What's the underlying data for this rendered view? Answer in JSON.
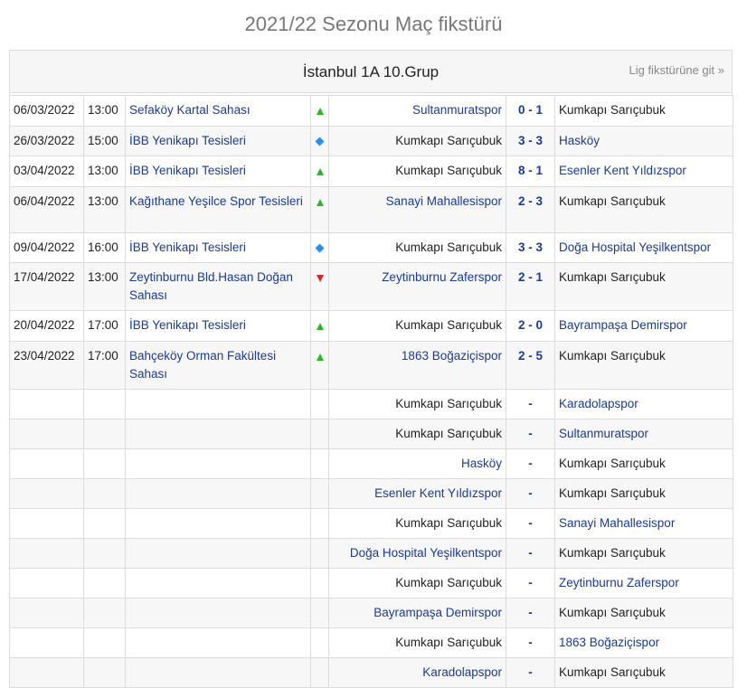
{
  "page": {
    "title": "2021/22 Sezonu Maç fikstürü",
    "group_title": "İstanbul 1A 10.Grup",
    "lig_link": "Lig fikstürüne git »"
  },
  "team_focus": "Kumkapı Sarıçubuk",
  "matches": [
    {
      "date": "06/03/2022",
      "time": "13:00",
      "venue": "Sefaköy Kartal Sahası",
      "result": "win",
      "home": "Sultanmuratspor",
      "score": "0 - 1",
      "away": "Kumkapı Sarıçubuk"
    },
    {
      "date": "26/03/2022",
      "time": "15:00",
      "venue": "İBB Yenikapı Tesisleri",
      "result": "draw",
      "home": "Kumkapı Sarıçubuk",
      "score": "3 - 3",
      "away": "Hasköy"
    },
    {
      "date": "03/04/2022",
      "time": "13:00",
      "venue": "İBB Yenikapı Tesisleri",
      "result": "win",
      "home": "Kumkapı Sarıçubuk",
      "score": "8 - 1",
      "away": "Esenler Kent Yıldızspor"
    },
    {
      "date": "06/04/2022",
      "time": "13:00",
      "venue": "Kağıthane Yeşilce Spor Tesisleri",
      "result": "win",
      "home": "Sanayi Mahallesispor",
      "score": "2 - 3",
      "away": "Kumkapı Sarıçubuk"
    },
    {
      "date": "09/04/2022",
      "time": "16:00",
      "venue": "İBB Yenikapı Tesisleri",
      "result": "draw",
      "home": "Kumkapı Sarıçubuk",
      "score": "3 - 3",
      "away": "Doğa Hospital Yeşilkentspor"
    },
    {
      "date": "17/04/2022",
      "time": "13:00",
      "venue": "Zeytinburnu Bld.Hasan Doğan Sahası",
      "result": "loss",
      "home": "Zeytinburnu Zaferspor",
      "score": "2 - 1",
      "away": "Kumkapı Sarıçubuk"
    },
    {
      "date": "20/04/2022",
      "time": "17:00",
      "venue": "İBB Yenikapı Tesisleri",
      "result": "win",
      "home": "Kumkapı Sarıçubuk",
      "score": "2 - 0",
      "away": "Bayrampaşa Demirspor"
    },
    {
      "date": "23/04/2022",
      "time": "17:00",
      "venue": "Bahçeköy Orman Fakültesi Sahası",
      "result": "win",
      "home": "1863 Boğaziçispor",
      "score": "2 - 5",
      "away": "Kumkapı Sarıçubuk"
    },
    {
      "date": "",
      "time": "",
      "venue": "",
      "result": "",
      "home": "Kumkapı Sarıçubuk",
      "score": "-",
      "away": "Karadolapspor"
    },
    {
      "date": "",
      "time": "",
      "venue": "",
      "result": "",
      "home": "Kumkapı Sarıçubuk",
      "score": "-",
      "away": "Sultanmuratspor"
    },
    {
      "date": "",
      "time": "",
      "venue": "",
      "result": "",
      "home": "Hasköy",
      "score": "-",
      "away": "Kumkapı Sarıçubuk"
    },
    {
      "date": "",
      "time": "",
      "venue": "",
      "result": "",
      "home": "Esenler Kent Yıldızspor",
      "score": "-",
      "away": "Kumkapı Sarıçubuk"
    },
    {
      "date": "",
      "time": "",
      "venue": "",
      "result": "",
      "home": "Kumkapı Sarıçubuk",
      "score": "-",
      "away": "Sanayi Mahallesispor"
    },
    {
      "date": "",
      "time": "",
      "venue": "",
      "result": "",
      "home": "Doğa Hospital Yeşilkentspor",
      "score": "-",
      "away": "Kumkapı Sarıçubuk"
    },
    {
      "date": "",
      "time": "",
      "venue": "",
      "result": "",
      "home": "Kumkapı Sarıçubuk",
      "score": "-",
      "away": "Zeytinburnu Zaferspor"
    },
    {
      "date": "",
      "time": "",
      "venue": "",
      "result": "",
      "home": "Bayrampaşa Demirspor",
      "score": "-",
      "away": "Kumkapı Sarıçubuk"
    },
    {
      "date": "",
      "time": "",
      "venue": "",
      "result": "",
      "home": "Kumkapı Sarıçubuk",
      "score": "-",
      "away": "1863 Boğaziçispor"
    },
    {
      "date": "",
      "time": "",
      "venue": "",
      "result": "",
      "home": "Karadolapspor",
      "score": "-",
      "away": "Kumkapı Sarıçubuk"
    }
  ],
  "colors": {
    "link": "#1a3a9c",
    "win": "#22bb22",
    "draw": "#1e90ff",
    "loss": "#dd2222"
  }
}
